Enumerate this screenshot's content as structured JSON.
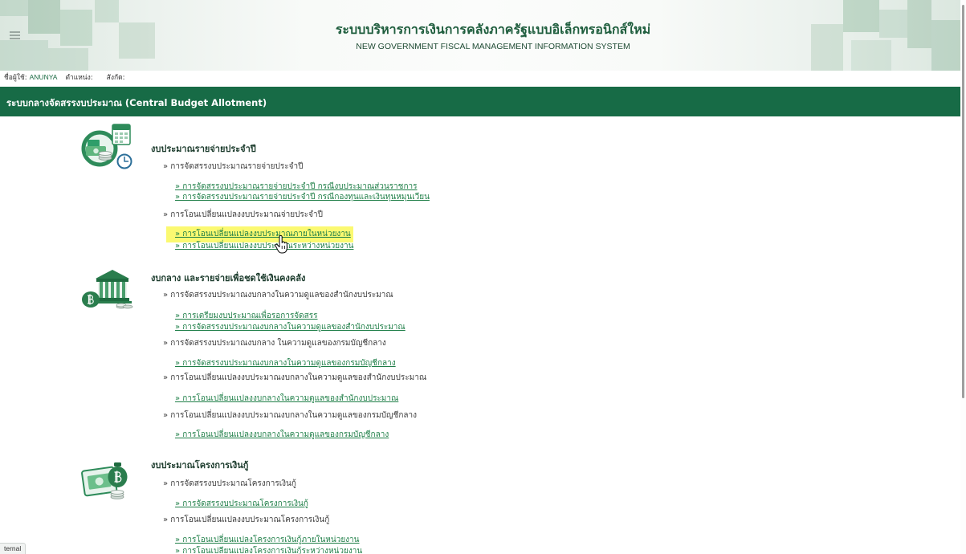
{
  "header": {
    "title_th": "ระบบบริหารการเงินการคลังภาครัฐแบบอิเล็กทรอนิกส์ใหม่",
    "title_en": "NEW GOVERNMENT FISCAL MANAGEMENT INFORMATION SYSTEM"
  },
  "user_info": {
    "username_label": "ชื่อผู้ใช้:",
    "username": "ANUNYA",
    "position_label": "ตำแหน่ง:",
    "affiliation_label": "สังกัด:"
  },
  "banner": {
    "title": "ระบบกลางจัดสรรงบประมาณ (Central Budget Allotment)"
  },
  "sections": [
    {
      "icon": "coins-calendar-icon",
      "heading": "งบประมาณรายจ่ายประจำปี",
      "groups": [
        {
          "title": "» การจัดสรรงบประมาณรายจ่ายประจำปี",
          "links": [
            "» การจัดสรรงบประมาณรายจ่ายประจำปี กรณีงบประมาณส่วนราชการ",
            "» การจัดสรรงบประมาณรายจ่ายประจำปี กรณีกองทุนและเงินทุนหมุนเวียน"
          ]
        },
        {
          "title": "» การโอนเปลี่ยนแปลงงบประมาณจ่ายประจำปี",
          "links": [
            "» การโอนเปลี่ยนแปลงงบประมาณภายในหน่วยงาน",
            "» การโอนเปลี่ยนแปลงงบประมาณระหว่างหน่วยงาน"
          ]
        }
      ]
    },
    {
      "icon": "bank-building-icon",
      "heading": "งบกลาง และรายจ่ายเพื่อชดใช้เงินคงคลัง",
      "groups": [
        {
          "title": "» การจัดสรรงบประมาณงบกลางในความดูแลของสำนักงบประมาณ",
          "links": [
            "» การเตรียมงบประมาณเพื่อรอการจัดสรร",
            "» การจัดสรรงบประมาณงบกลางในความดูแลของสำนักงบประมาณ"
          ]
        },
        {
          "title": "» การจัดสรรงบประมาณงบกลาง ในความดูแลของกรมบัญชีกลาง",
          "links": [
            "» การจัดสรรงบประมาณงบกลางในความดูแลของกรมบัญชีกลาง"
          ]
        },
        {
          "title": "» การโอนเปลี่ยนแปลงงบประมาณงบกลางในความดูแลของสำนักงบประมาณ",
          "links": [
            "» การโอนเปลี่ยนแปลงงบกลางในความดูแลของสำนักงบประมาณ"
          ]
        },
        {
          "title": "» การโอนเปลี่ยนแปลงงบประมาณงบกลางในความดูแลของกรมบัญชีกลาง",
          "links": [
            "» การโอนเปลี่ยนแปลงงบกลางในความดูแลของกรมบัญชีกลาง"
          ]
        }
      ]
    },
    {
      "icon": "money-bag-icon",
      "heading": "งบประมาณโครงการเงินกู้",
      "groups": [
        {
          "title": "» การจัดสรรงบประมาณโครงการเงินกู้",
          "links": [
            "» การจัดสรรงบประมาณโครงการเงินกู้"
          ]
        },
        {
          "title": "» การโอนเปลี่ยนแปลงงบประมาณโครงการเงินกู้",
          "links": [
            "» การโอนเปลี่ยนแปลงโครงการเงินกู้ภายในหน่วยงาน",
            "» การโอนเปลี่ยนแปลงโครงการเงินกู้ระหว่างหน่วยงาน"
          ]
        }
      ]
    }
  ],
  "status_bar": {
    "text": "ternal"
  },
  "icons": {
    "menu": "hamburger-icon",
    "cursor": "hand-pointer-icon"
  },
  "colors": {
    "banner_bg": "#176b46",
    "link": "#1f7f48",
    "highlight": "#fbf971",
    "heading": "#1b3b2c",
    "header_title": "#1e5d3d",
    "text": "#3c3c3c"
  }
}
